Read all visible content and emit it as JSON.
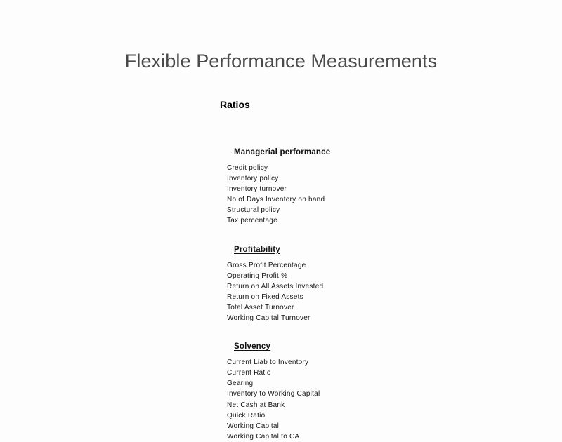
{
  "document": {
    "title": "Flexible Performance Measurements",
    "section_label": "Ratios"
  },
  "groups": [
    {
      "heading": "Managerial performance",
      "items": [
        "Credit policy",
        "Inventory policy",
        "Inventory turnover",
        "No of Days Inventory on hand",
        "Structural policy",
        "Tax percentage"
      ]
    },
    {
      "heading": "Profitability",
      "items": [
        "Gross Profit Percentage",
        "Operating Profit %",
        "Return on All Assets Invested",
        "Return on Fixed Assets",
        "Total Asset Turnover",
        "Working Capital Turnover"
      ]
    },
    {
      "heading": "Solvency",
      "items": [
        "Current Liab to Inventory",
        "Current Ratio",
        "Gearing",
        "Inventory to Working Capital",
        "Net Cash at Bank",
        "Quick Ratio",
        "Working Capital",
        "Working Capital to CA"
      ]
    }
  ],
  "colors": {
    "background": "#fdfdfd",
    "title_text": "#4a4a4a",
    "body_text": "#161616",
    "heading_text": "#111111"
  }
}
